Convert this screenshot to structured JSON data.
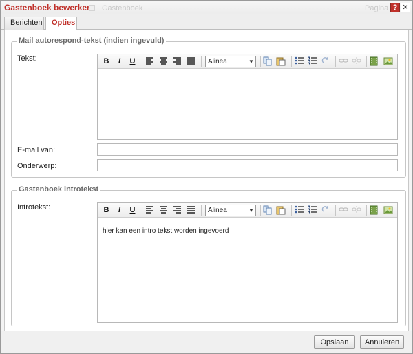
{
  "window": {
    "title": "Gastenboek bewerken",
    "ghost_left": "Gastenboek",
    "ghost_right": "Pagina",
    "help_label": "?",
    "close_label": "✕"
  },
  "tabs": [
    {
      "label": "Berichten",
      "active": false
    },
    {
      "label": "Opties",
      "active": true
    }
  ],
  "section1": {
    "legend": "Mail autorespond-tekst (indien ingevuld)",
    "tekst_label": "Tekst:",
    "editor_text": "",
    "email_label": "E-mail van:",
    "email_value": "",
    "subject_label": "Onderwerp:",
    "subject_value": ""
  },
  "section2": {
    "legend": "Gastenboek introtekst",
    "intro_label": "Introtekst:",
    "editor_text": "hier kan een intro tekst worden ingevoerd"
  },
  "toolbar": {
    "bold": "B",
    "italic": "I",
    "underline": "U",
    "format_value": "Alinea"
  },
  "footer": {
    "save_label": "Opslaan",
    "cancel_label": "Annuleren"
  },
  "colors": {
    "accent": "#c0302a"
  }
}
